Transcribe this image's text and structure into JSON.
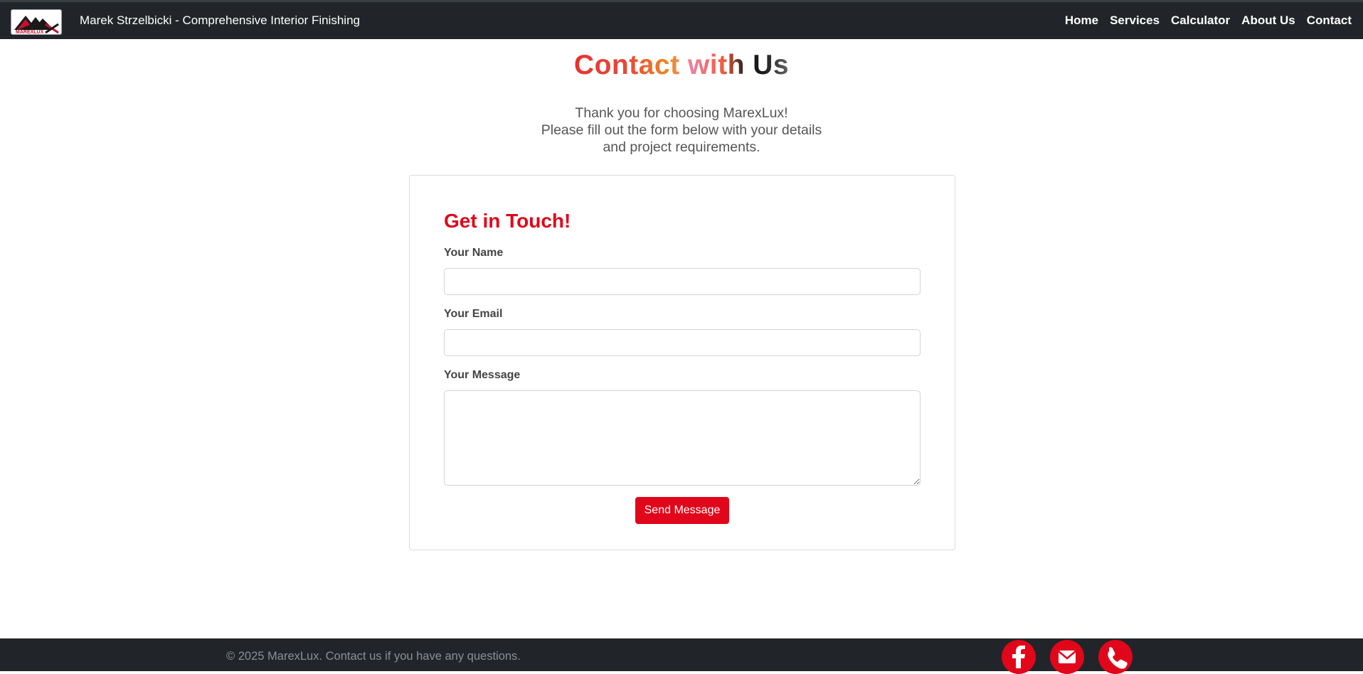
{
  "header": {
    "logo_alt": "MAREXLUX",
    "brand": "Marek Strzelbicki - Comprehensive Interior Finishing",
    "nav": [
      "Home",
      "Services",
      "Calculator",
      "About Us",
      "Contact"
    ]
  },
  "main": {
    "title": "Contact with Us",
    "intro_lines": [
      "Thank you for choosing MarexLux!",
      "Please fill out the form below with your details",
      "and project requirements."
    ]
  },
  "form": {
    "title": "Get in Touch!",
    "name_label": "Your Name",
    "name_value": "",
    "email_label": "Your Email",
    "email_value": "",
    "message_label": "Your Message",
    "message_value": "",
    "submit_label": "Send Message"
  },
  "footer": {
    "copyright": "© 2025 MarexLux. Contact us if you have any questions.",
    "social": [
      "facebook-icon",
      "mail-icon",
      "phone-icon"
    ]
  },
  "colors": {
    "topbar": "#212529",
    "accent": "#e1061a",
    "text": "#555555"
  }
}
